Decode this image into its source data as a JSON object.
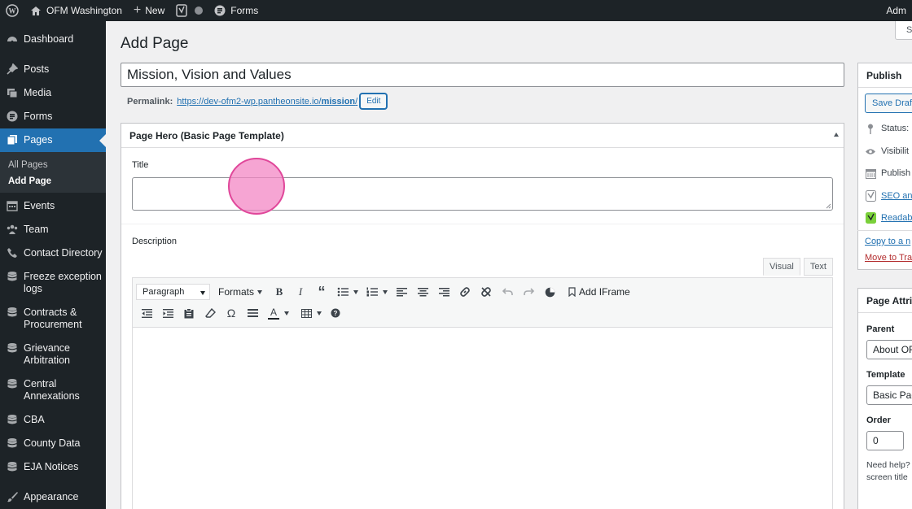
{
  "adminbar": {
    "site_name": "OFM Washington",
    "new_label": "New",
    "forms_label": "Forms",
    "account_label": "Adm"
  },
  "sidebar": {
    "items": [
      {
        "label": "Dashboard",
        "icon": "dashboard-icon"
      },
      {
        "label": "Posts",
        "icon": "pin-icon"
      },
      {
        "label": "Media",
        "icon": "media-icon"
      },
      {
        "label": "Forms",
        "icon": "forms-icon"
      },
      {
        "label": "Pages",
        "icon": "pages-icon"
      },
      {
        "label": "Events",
        "icon": "calendar-icon"
      },
      {
        "label": "Team",
        "icon": "team-icon"
      },
      {
        "label": "Contact Directory",
        "icon": "database-icon"
      },
      {
        "label": "Freeze exception logs",
        "icon": "database-icon"
      },
      {
        "label": "Contracts & Procurement",
        "icon": "database-icon"
      },
      {
        "label": "Grievance Arbitration",
        "icon": "database-icon"
      },
      {
        "label": "Central Annexations",
        "icon": "database-icon"
      },
      {
        "label": "CBA",
        "icon": "database-icon"
      },
      {
        "label": "County Data",
        "icon": "database-icon"
      },
      {
        "label": "EJA Notices",
        "icon": "database-icon"
      },
      {
        "label": "Appearance",
        "icon": "appearance-icon"
      }
    ],
    "submenu": [
      "All Pages",
      "Add Page"
    ]
  },
  "main": {
    "page_title": "Add Page",
    "screen_options": "Sc",
    "post_title": "Mission, Vision and Values",
    "permalink_label": "Permalink:",
    "permalink_base": "https://dev-ofm2-wp.pantheonsite.io/",
    "permalink_slug": "mission",
    "permalink_trail": "/",
    "edit_label": "Edit"
  },
  "hero": {
    "header": "Page Hero (Basic Page Template)",
    "title_label": "Title",
    "title_value": "",
    "description_label": "Description",
    "tab_visual": "Visual",
    "tab_text": "Text",
    "format_select": "Paragraph",
    "formats_label": "Formats",
    "iframe_label": "Add IFrame"
  },
  "publish": {
    "header": "Publish",
    "save_draft": "Save Draf",
    "status": "Status:",
    "visibility": "Visibilit",
    "publish_label": "Publish",
    "seo": "SEO ana",
    "readability": "Readab",
    "copy": "Copy to a n",
    "trash": "Move to Tra"
  },
  "attributes": {
    "header": "Page Attri",
    "parent_label": "Parent",
    "parent_value": "About OF",
    "template_label": "Template",
    "template_value": "Basic Pag",
    "order_label": "Order",
    "order_value": "0",
    "help_line1": "Need help?",
    "help_line2": "screen title"
  },
  "colors": {
    "admin_dark": "#1d2327",
    "accent": "#2271b1",
    "background": "#f0f0f1",
    "highlight": "#f387c4"
  }
}
